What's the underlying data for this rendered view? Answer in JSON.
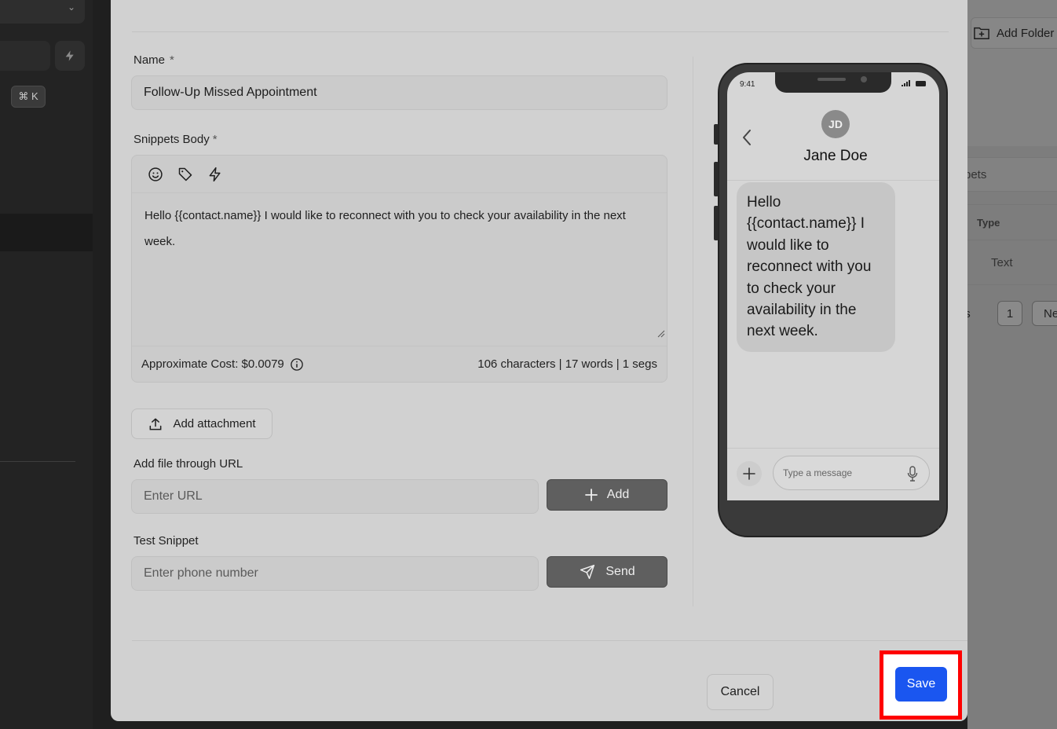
{
  "background": {
    "sidebar": {
      "shortcut": "⌘ K"
    },
    "right_page": {
      "add_folder_label": "Add Folder",
      "tab_partial": "pets",
      "column_type": "Type",
      "cell_type": "Text",
      "pagination_left_partial": "s",
      "page_number": "1",
      "next_partial": "Ne"
    }
  },
  "form": {
    "name_label": "Name",
    "required_mark": "*",
    "name_value": "Follow-Up Missed Appointment",
    "body_label": "Snippets Body",
    "body_text": "Hello {{contact.name}} I would like to reconnect with you to check your availability in the next week.",
    "toolbar_icons": [
      "emoji-icon",
      "tag-icon",
      "bolt-icon"
    ],
    "cost_text": "Approximate Cost: $0.0079",
    "stats_text": "106 characters | 17 words | 1 segs",
    "attachment_button": "Add attachment",
    "url_label": "Add file through URL",
    "url_placeholder": "Enter URL",
    "add_button": "Add",
    "test_label": "Test Snippet",
    "phone_placeholder": "Enter phone number",
    "send_button": "Send"
  },
  "preview": {
    "time": "9:41",
    "avatar_initials": "JD",
    "contact_name": "Jane Doe",
    "message": "Hello {{contact.name}} I would like to reconnect with you to check your availability in the next week.",
    "composer_placeholder": "Type a message"
  },
  "footer": {
    "cancel_button": "Cancel",
    "save_button": "Save"
  },
  "colors": {
    "save_button": "#1a56f0",
    "highlight_border": "#ff0000"
  }
}
